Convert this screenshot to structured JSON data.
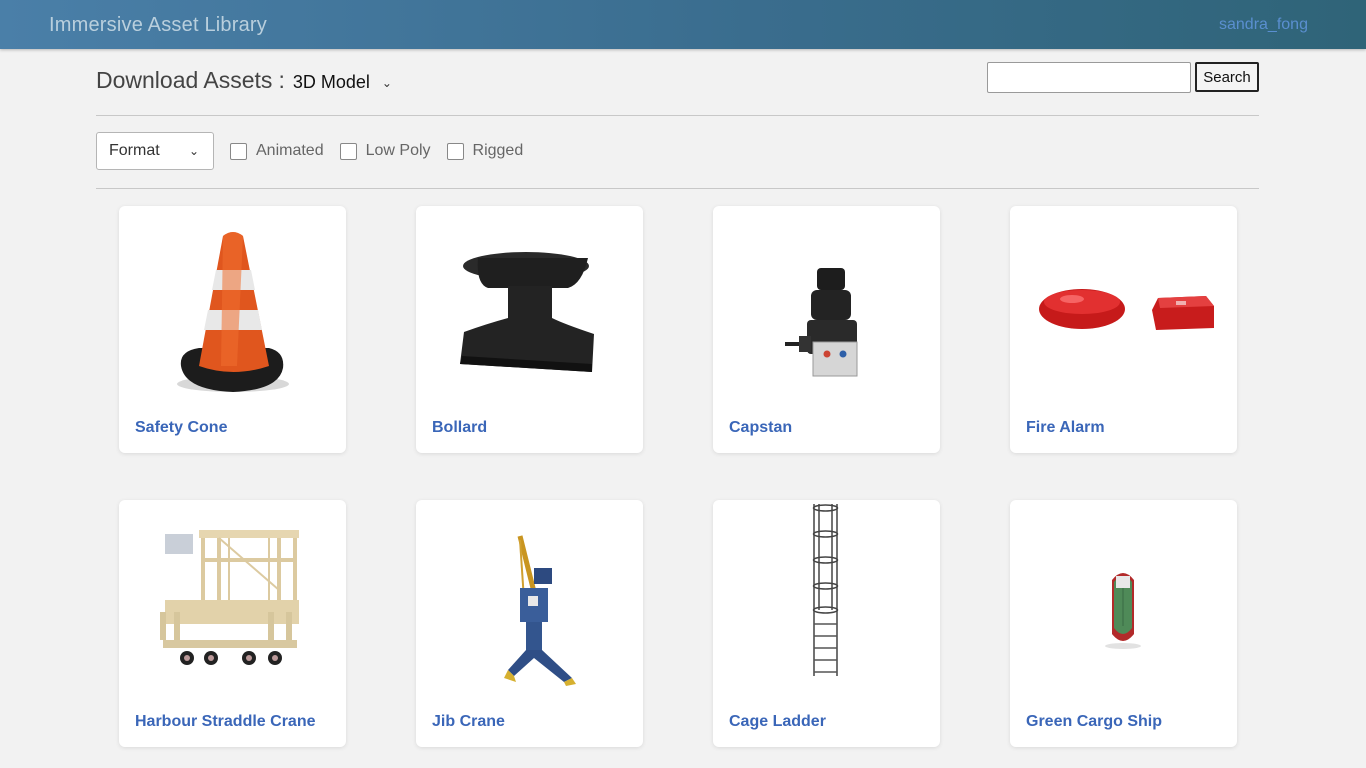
{
  "header": {
    "app_title": "Immersive Asset Library",
    "username": "sandra_fong"
  },
  "toolbar": {
    "title": "Download Assets",
    "separator": ":",
    "asset_type": "3D Model",
    "search_placeholder": "",
    "search_label": "Search"
  },
  "filters": {
    "format_label": "Format",
    "checkboxes": [
      {
        "label": "Animated",
        "checked": false
      },
      {
        "label": "Low Poly",
        "checked": false
      },
      {
        "label": "Rigged",
        "checked": false
      }
    ]
  },
  "assets": [
    {
      "name": "Safety Cone",
      "icon": "safety-cone-icon"
    },
    {
      "name": "Bollard",
      "icon": "bollard-icon"
    },
    {
      "name": "Capstan",
      "icon": "capstan-icon"
    },
    {
      "name": "Fire Alarm",
      "icon": "fire-alarm-icon"
    },
    {
      "name": "Harbour Straddle Crane",
      "icon": "straddle-crane-icon"
    },
    {
      "name": "Jib Crane",
      "icon": "jib-crane-icon"
    },
    {
      "name": "Cage Ladder",
      "icon": "cage-ladder-icon"
    },
    {
      "name": "Green Cargo Ship",
      "icon": "cargo-ship-icon"
    }
  ],
  "colors": {
    "header_start": "#4a7fa8",
    "header_end": "#2f6478",
    "link": "#3a66b8",
    "background": "#f2f2f2"
  }
}
